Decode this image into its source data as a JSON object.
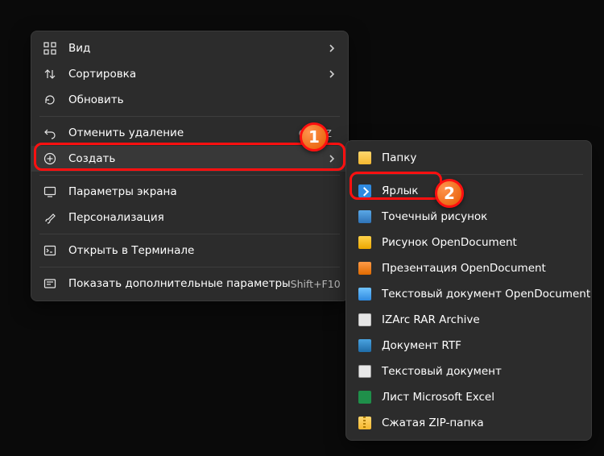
{
  "main_menu": {
    "items": [
      {
        "label": "Вид",
        "shortcut": "",
        "has_sub": true
      },
      {
        "label": "Сортировка",
        "shortcut": "",
        "has_sub": true
      },
      {
        "label": "Обновить",
        "shortcut": "",
        "has_sub": false
      }
    ],
    "group2": [
      {
        "label": "Отменить удаление",
        "shortcut": "Ctrl+Z",
        "has_sub": false
      },
      {
        "label": "Создать",
        "shortcut": "",
        "has_sub": true,
        "highlight": true
      }
    ],
    "group3": [
      {
        "label": "Параметры экрана",
        "shortcut": "",
        "has_sub": false
      },
      {
        "label": "Персонализация",
        "shortcut": "",
        "has_sub": false
      }
    ],
    "group4": [
      {
        "label": "Открыть в Терминале",
        "shortcut": "",
        "has_sub": false
      }
    ],
    "group5": [
      {
        "label": "Показать дополнительные параметры",
        "shortcut": "Shift+F10",
        "has_sub": false
      }
    ]
  },
  "sub_menu": {
    "items": [
      {
        "label": "Папку",
        "kind": "folder"
      },
      {
        "label": "Ярлык",
        "kind": "shortcut",
        "highlight": true
      },
      {
        "label": "Точечный рисунок",
        "kind": "bmp"
      },
      {
        "label": "Рисунок OpenDocument",
        "kind": "odg"
      },
      {
        "label": "Презентация OpenDocument",
        "kind": "odp"
      },
      {
        "label": "Текстовый документ OpenDocument",
        "kind": "odt"
      },
      {
        "label": "IZArc RAR Archive",
        "kind": "rar"
      },
      {
        "label": "Документ RTF",
        "kind": "rtf"
      },
      {
        "label": "Текстовый документ",
        "kind": "txt"
      },
      {
        "label": "Лист Microsoft Excel",
        "kind": "xlsx"
      },
      {
        "label": "Сжатая ZIP-папка",
        "kind": "zip"
      }
    ]
  },
  "annotations": {
    "badge1": "1",
    "badge2": "2"
  }
}
